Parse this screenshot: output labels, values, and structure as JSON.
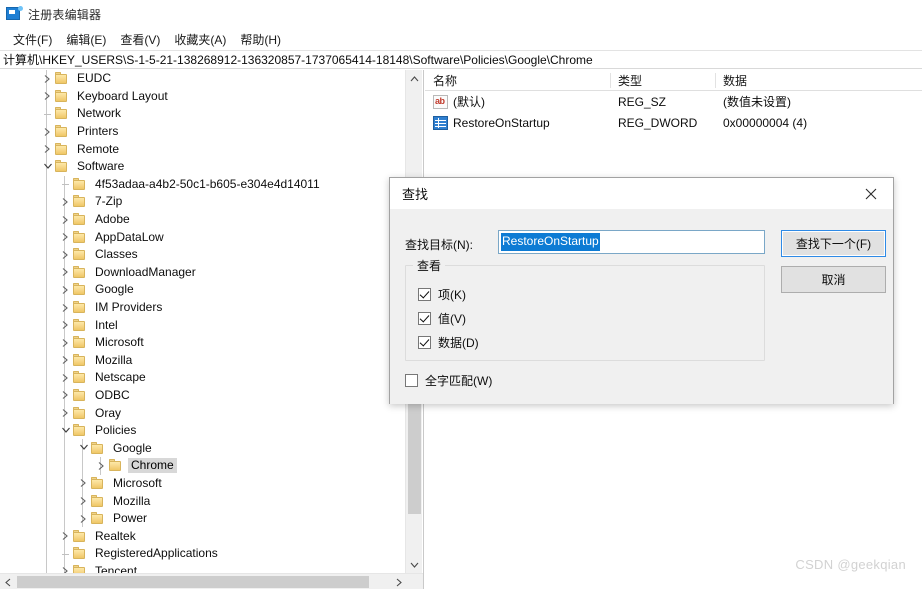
{
  "window": {
    "title": "注册表编辑器",
    "icon": "registry-editor-icon"
  },
  "menubar": {
    "items": [
      {
        "label": "文件(F)"
      },
      {
        "label": "编辑(E)"
      },
      {
        "label": "查看(V)"
      },
      {
        "label": "收藏夹(A)"
      },
      {
        "label": "帮助(H)"
      }
    ]
  },
  "address": {
    "path": "计算机\\HKEY_USERS\\S-1-5-21-138268912-136320857-1737065414-18148\\Software\\Policies\\Google\\Chrome"
  },
  "tree": {
    "items": [
      {
        "label": "EUDC",
        "depth": 1,
        "state": "collapsed",
        "selected": false
      },
      {
        "label": "Keyboard Layout",
        "depth": 1,
        "state": "collapsed",
        "selected": false
      },
      {
        "label": "Network",
        "depth": 1,
        "state": "leaf",
        "selected": false
      },
      {
        "label": "Printers",
        "depth": 1,
        "state": "collapsed",
        "selected": false
      },
      {
        "label": "Remote",
        "depth": 1,
        "state": "collapsed",
        "selected": false
      },
      {
        "label": "Software",
        "depth": 1,
        "state": "expanded",
        "selected": false
      },
      {
        "label": "4f53adaa-a4b2-50c1-b605-e304e4d14011",
        "depth": 2,
        "state": "leaf",
        "selected": false
      },
      {
        "label": "7-Zip",
        "depth": 2,
        "state": "collapsed",
        "selected": false
      },
      {
        "label": "Adobe",
        "depth": 2,
        "state": "collapsed",
        "selected": false
      },
      {
        "label": "AppDataLow",
        "depth": 2,
        "state": "collapsed",
        "selected": false
      },
      {
        "label": "Classes",
        "depth": 2,
        "state": "collapsed",
        "selected": false
      },
      {
        "label": "DownloadManager",
        "depth": 2,
        "state": "collapsed",
        "selected": false
      },
      {
        "label": "Google",
        "depth": 2,
        "state": "collapsed",
        "selected": false
      },
      {
        "label": "IM Providers",
        "depth": 2,
        "state": "collapsed",
        "selected": false
      },
      {
        "label": "Intel",
        "depth": 2,
        "state": "collapsed",
        "selected": false
      },
      {
        "label": "Microsoft",
        "depth": 2,
        "state": "collapsed",
        "selected": false
      },
      {
        "label": "Mozilla",
        "depth": 2,
        "state": "collapsed",
        "selected": false
      },
      {
        "label": "Netscape",
        "depth": 2,
        "state": "collapsed",
        "selected": false
      },
      {
        "label": "ODBC",
        "depth": 2,
        "state": "collapsed",
        "selected": false
      },
      {
        "label": "Oray",
        "depth": 2,
        "state": "collapsed",
        "selected": false
      },
      {
        "label": "Policies",
        "depth": 2,
        "state": "expanded",
        "selected": false
      },
      {
        "label": "Google",
        "depth": 3,
        "state": "expanded",
        "selected": false
      },
      {
        "label": "Chrome",
        "depth": 4,
        "state": "collapsed",
        "selected": true
      },
      {
        "label": "Microsoft",
        "depth": 3,
        "state": "collapsed",
        "selected": false
      },
      {
        "label": "Mozilla",
        "depth": 3,
        "state": "collapsed",
        "selected": false
      },
      {
        "label": "Power",
        "depth": 3,
        "state": "collapsed",
        "selected": false
      },
      {
        "label": "Realtek",
        "depth": 2,
        "state": "collapsed",
        "selected": false
      },
      {
        "label": "RegisteredApplications",
        "depth": 2,
        "state": "leaf",
        "selected": false
      },
      {
        "label": "Tencent",
        "depth": 2,
        "state": "collapsed",
        "selected": false
      }
    ]
  },
  "values": {
    "columns": [
      {
        "label": "名称"
      },
      {
        "label": "类型"
      },
      {
        "label": "数据"
      }
    ],
    "rows": [
      {
        "name": "(默认)",
        "type": "REG_SZ",
        "data": "(数值未设置)",
        "icon": "string-value-icon"
      },
      {
        "name": "RestoreOnStartup",
        "type": "REG_DWORD",
        "data": "0x00000004 (4)",
        "icon": "dword-value-icon"
      }
    ]
  },
  "find_dialog": {
    "title": "查找",
    "close_icon": "close-icon",
    "target_label": "查找目标(N):",
    "target_value": "RestoreOnStartup",
    "group_title": "查看",
    "checkboxes": [
      {
        "label": "项(K)",
        "checked": true
      },
      {
        "label": "值(V)",
        "checked": true
      },
      {
        "label": "数据(D)",
        "checked": true
      }
    ],
    "whole_word": {
      "label": "全字匹配(W)",
      "checked": false
    },
    "find_next_label": "查找下一个(F)",
    "cancel_label": "取消"
  },
  "watermark": {
    "text": "CSDN @geekqian"
  },
  "colors": {
    "selection_blue": "#0d7bd4",
    "folder_yellow": "#f6d483",
    "accent": "#2e8ae6",
    "tree_selection": "#d8d8d8"
  }
}
